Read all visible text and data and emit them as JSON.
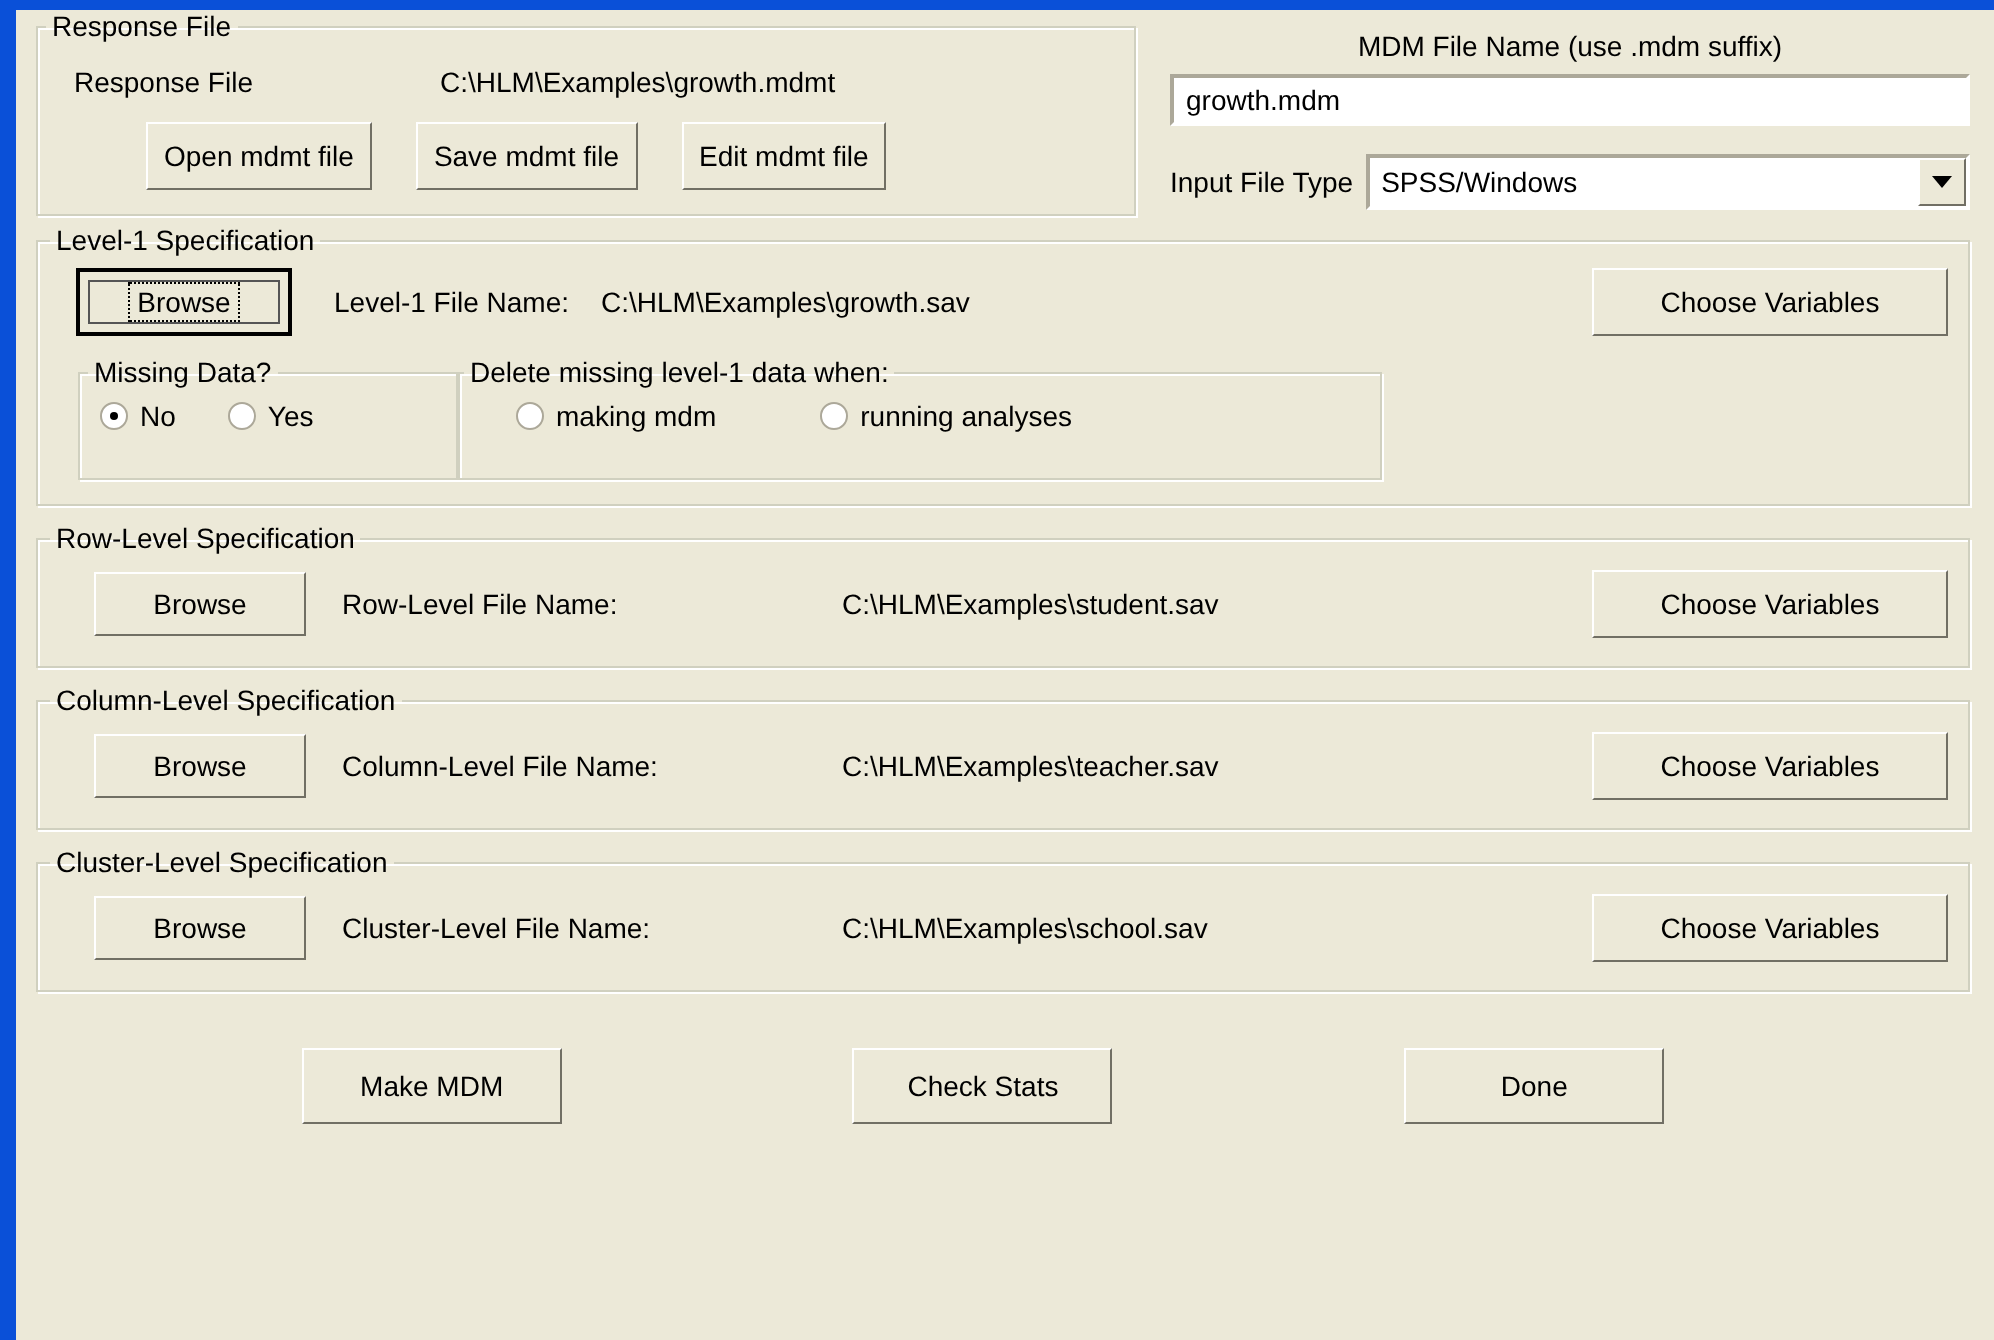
{
  "response_file": {
    "title": "Response File",
    "label": "Response File",
    "path": "C:\\HLM\\Examples\\growth.mdmt",
    "buttons": [
      {
        "label": "Open mdmt file"
      },
      {
        "label": "Save mdmt file"
      },
      {
        "label": "Edit mdmt file"
      }
    ]
  },
  "mdm_file": {
    "label": "MDM File Name (use .mdm suffix)",
    "value": "growth.mdm"
  },
  "input_file_type": {
    "label": "Input File Type",
    "value": "SPSS/Windows"
  },
  "level1": {
    "title": "Level-1 Specification",
    "browse": {
      "label": "Browse",
      "focused": true
    },
    "file_label": "Level-1 File Name:",
    "path": "C:\\HLM\\Examples\\growth.sav",
    "choose": "Choose Variables",
    "missing_data": {
      "title": "Missing Data?",
      "options": [
        {
          "label": "No",
          "selected": true
        },
        {
          "label": "Yes",
          "selected": false
        }
      ]
    },
    "delete_when": {
      "title": "Delete missing level-1 data when:",
      "options": [
        {
          "label": "making mdm",
          "selected": false
        },
        {
          "label": "running analyses",
          "selected": false
        }
      ]
    }
  },
  "sections": [
    {
      "title": "Row-Level Specification",
      "browse": {
        "label": "Browse",
        "focused": false
      },
      "file_label": "Row-Level File Name:",
      "path": "C:\\HLM\\Examples\\student.sav",
      "choose": "Choose Variables"
    },
    {
      "title": "Column-Level Specification",
      "browse": {
        "label": "Browse",
        "focused": false
      },
      "file_label": "Column-Level File Name:",
      "path": "C:\\HLM\\Examples\\teacher.sav",
      "choose": "Choose Variables"
    },
    {
      "title": "Cluster-Level Specification",
      "browse": {
        "label": "Browse",
        "focused": false
      },
      "file_label": "Cluster-Level File Name:",
      "path": "C:\\HLM\\Examples\\school.sav",
      "choose": "Choose Variables"
    }
  ],
  "footer_buttons": [
    {
      "label": "Make MDM"
    },
    {
      "label": "Check Stats"
    },
    {
      "label": "Done"
    }
  ]
}
